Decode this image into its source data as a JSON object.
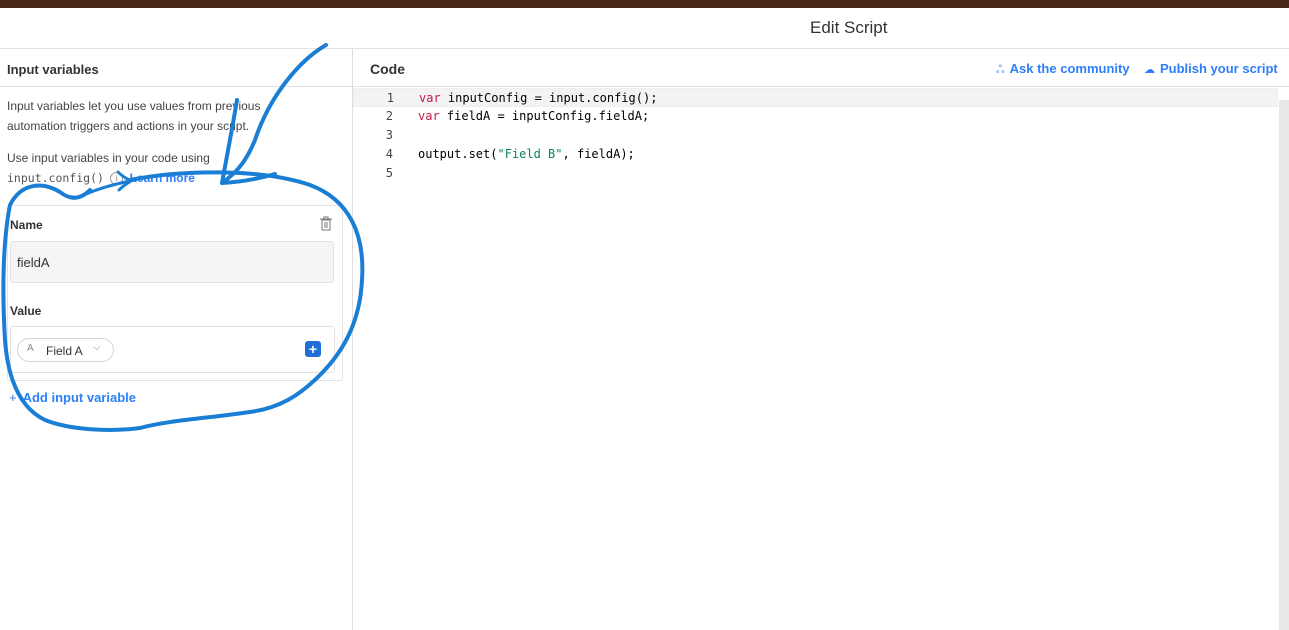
{
  "header": {
    "title": "Edit Script"
  },
  "left_panel": {
    "title": "Input variables",
    "description": "Input variables let you use values from previous automation triggers and actions in your script.",
    "usage_text": "Use input variables in your code using",
    "usage_code": "input.config()",
    "learn_more": "Learn more",
    "variable": {
      "name_label": "Name",
      "name_value": "fieldA",
      "value_label": "Value",
      "value_token": "Field A",
      "field_type_glyph": "A"
    },
    "add_variable": "Add input variable"
  },
  "code_panel": {
    "title": "Code",
    "ask_community": "Ask the community",
    "publish": "Publish your script",
    "lines": [
      {
        "number": "1",
        "keyword": "var",
        "text": " inputConfig = input.config();"
      },
      {
        "number": "2",
        "keyword": "var",
        "text": " fieldA = inputConfig.fieldA;"
      },
      {
        "number": "3",
        "text": ""
      },
      {
        "number": "4",
        "pre": "output.set(",
        "string": "\"Field B\"",
        "post": ", fieldA);"
      },
      {
        "number": "5",
        "text": ""
      }
    ]
  },
  "colors": {
    "accent": "#2d7ff9",
    "annotation": "#1a7fd4",
    "top_bar": "#4a2718",
    "keyword": "#c41a4a",
    "string": "#098658"
  },
  "icons": [
    "trash-icon",
    "info-icon",
    "plus-icon",
    "chevron-down-icon",
    "community-icon",
    "publish-icon"
  ]
}
